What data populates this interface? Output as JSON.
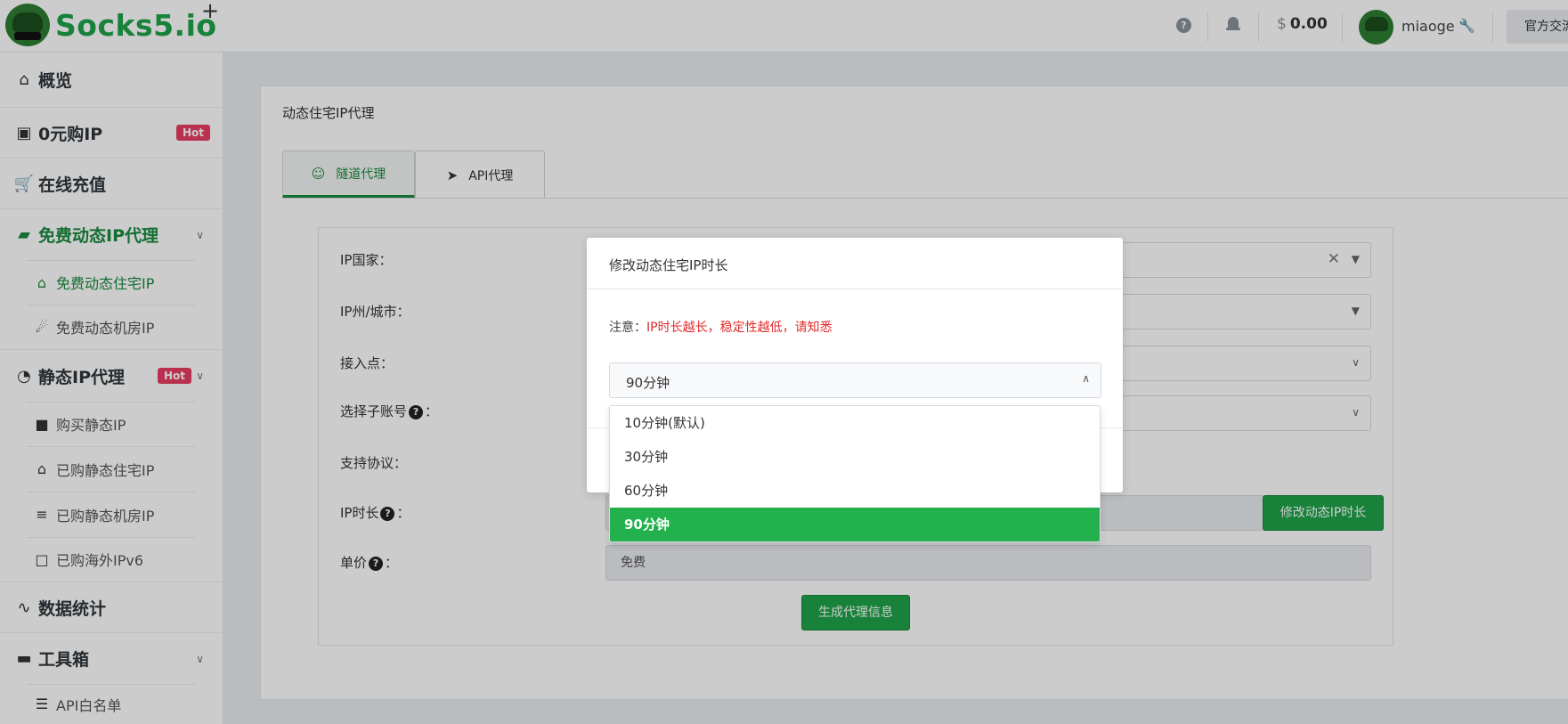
{
  "header": {
    "logo_text": "Socks5.io",
    "logo_plus": "+",
    "help_icon": "?",
    "balance_currency": "$",
    "balance_value": "0.00",
    "username": "miaoge",
    "official_button": "官方交流"
  },
  "sidebar": {
    "items": [
      {
        "label": "概览",
        "icon": "home-icon"
      },
      {
        "label": "0元购IP",
        "icon": "store-icon",
        "badge": "Hot"
      },
      {
        "label": "在线充值",
        "icon": "cart-icon"
      },
      {
        "label": "免费动态IP代理",
        "icon": "map-icon"
      },
      {
        "label": "免费动态住宅IP",
        "icon": "house-icon"
      },
      {
        "label": "免费动态机房IP",
        "icon": "satellite-icon"
      },
      {
        "label": "静态IP代理",
        "icon": "globe-icon",
        "badge": "Hot"
      },
      {
        "label": "购买静态IP",
        "icon": "bag-icon"
      },
      {
        "label": "已购静态住宅IP",
        "icon": "house-signal-icon"
      },
      {
        "label": "已购静态机房IP",
        "icon": "database-icon"
      },
      {
        "label": "已购海外IPv6",
        "icon": "devices-icon"
      },
      {
        "label": "数据统计",
        "icon": "chart-line-icon"
      },
      {
        "label": "工具箱",
        "icon": "toolbox-icon"
      },
      {
        "label": "API白名单",
        "icon": "list-check-icon"
      }
    ]
  },
  "main": {
    "card_title": "动态住宅IP代理",
    "tabs": [
      {
        "label": "隧道代理",
        "icon": "user-check-icon"
      },
      {
        "label": "API代理",
        "icon": "location-arrow-icon"
      }
    ],
    "form": {
      "country_label": "IP国家：",
      "city_label": "IP州/城市：",
      "access_label": "接入点：",
      "subaccount_label": "选择子账号",
      "protocol_label": "支持协议：",
      "duration_label": "IP时长",
      "price_label": "单价",
      "colon": "：",
      "price_value": "免费",
      "modify_button": "修改动态IP时长",
      "generate_button": "生成代理信息"
    }
  },
  "modal": {
    "title": "修改动态住宅IP时长",
    "note_prefix": "注意：",
    "note_warning": "IP时长越长，稳定性越低，请知悉",
    "selected_value": "90分钟",
    "options": [
      "10分钟(默认)",
      "30分钟",
      "60分钟",
      "90分钟"
    ],
    "selected_index": 3
  },
  "colors": {
    "brand_green": "#1fa34a",
    "hot_badge": "#e83e63",
    "warning_red": "#e02b2b",
    "option_selected": "#23b14d"
  }
}
